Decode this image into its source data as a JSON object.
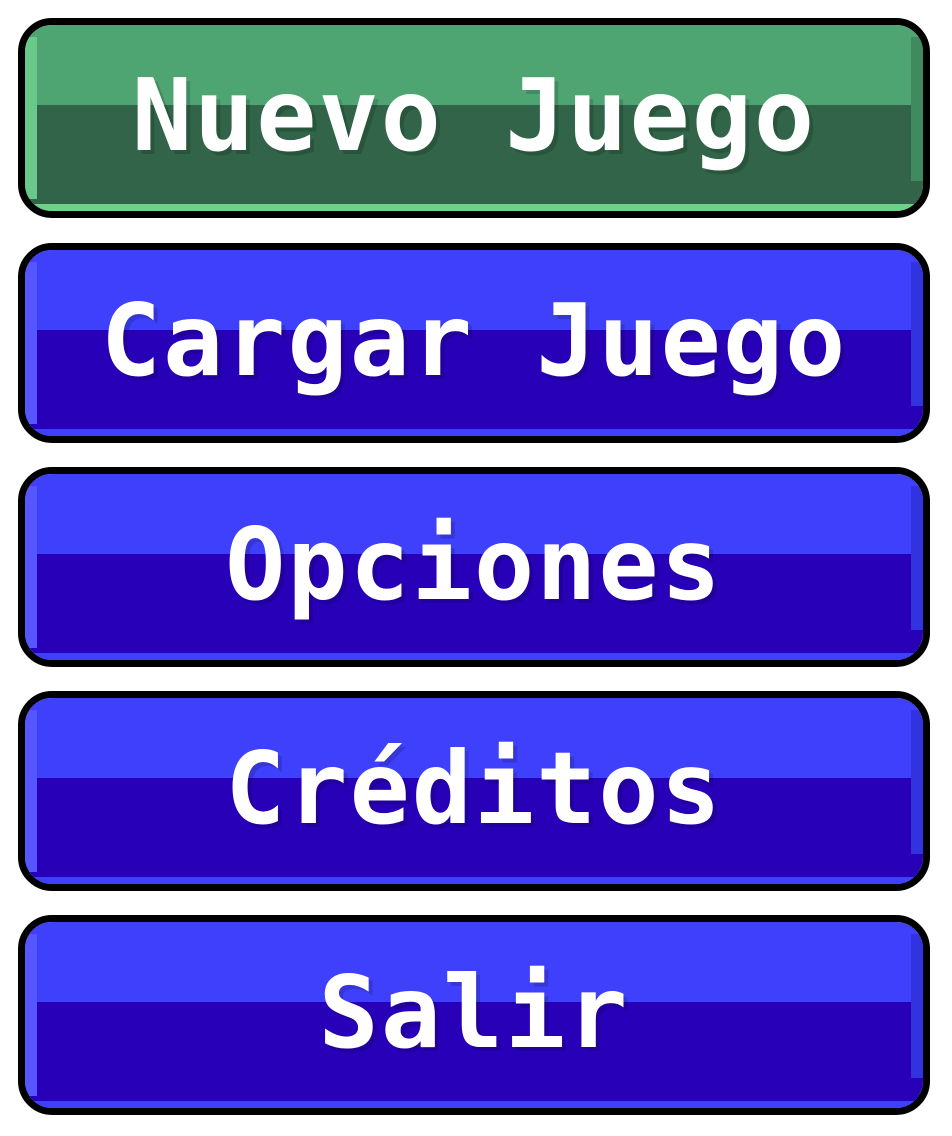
{
  "menu": {
    "items": [
      {
        "label": "Nuevo Juego",
        "state": "selected"
      },
      {
        "label": "Cargar Juego",
        "state": "normal"
      },
      {
        "label": "Opciones",
        "state": "normal"
      },
      {
        "label": "Créditos",
        "state": "normal"
      },
      {
        "label": "Salir",
        "state": "normal"
      }
    ]
  },
  "colors": {
    "selected_light": "#4ea572",
    "selected_dark": "#316448",
    "selected_rim": "#6fd08a",
    "normal_light": "#3f40fb",
    "normal_dark": "#2800b8",
    "outline": "#000000",
    "text": "#ffffff"
  }
}
